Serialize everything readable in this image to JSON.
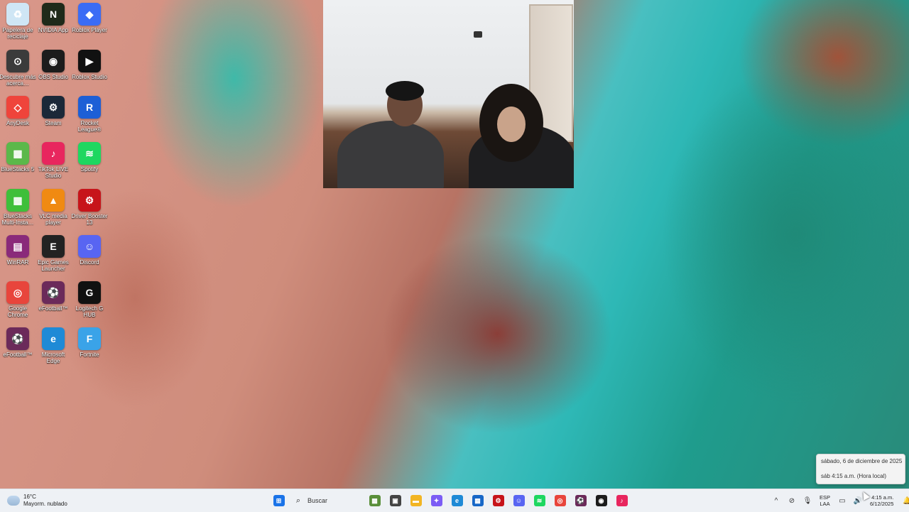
{
  "desktop_icons": [
    {
      "label": "Papelera de reciclaje",
      "icon": "recycle-bin-icon",
      "color": "#cfe6f5",
      "glyph": "♻"
    },
    {
      "label": "NVIDIA App",
      "icon": "nvidia-icon",
      "color": "#1f2a1a",
      "glyph": "N"
    },
    {
      "label": "Roblox Player",
      "icon": "roblox-icon",
      "color": "#3b6cf5",
      "glyph": "◆"
    },
    {
      "label": "Descubre más acerca…",
      "icon": "spotlight-icon",
      "color": "#3b3b3b",
      "glyph": "⊙"
    },
    {
      "label": "OBS Studio",
      "icon": "obs-icon",
      "color": "#1c1c1c",
      "glyph": "◉"
    },
    {
      "label": "Roblox Studio",
      "icon": "roblox-studio-icon",
      "color": "#111111",
      "glyph": "▶"
    },
    {
      "label": "AnyDesk",
      "icon": "anydesk-icon",
      "color": "#ef443b",
      "glyph": "◇"
    },
    {
      "label": "Steam",
      "icon": "steam-icon",
      "color": "#1b2838",
      "glyph": "⚙"
    },
    {
      "label": "Rocket League®",
      "icon": "rocket-league-icon",
      "color": "#1d5fd6",
      "glyph": "R"
    },
    {
      "label": "BlueStacks 5",
      "icon": "bluestacks-icon",
      "color": "#5bb84a",
      "glyph": "▦"
    },
    {
      "label": "TikTok LIVE Studio",
      "icon": "tiktok-live-icon",
      "color": "#e8265e",
      "glyph": "♪"
    },
    {
      "label": "Spotify",
      "icon": "spotify-icon",
      "color": "#1ed760",
      "glyph": "≋"
    },
    {
      "label": "BlueStacks Multi-Insta…",
      "icon": "bluestacks-multi-icon",
      "color": "#3fbf3a",
      "glyph": "▦"
    },
    {
      "label": "VLC media player",
      "icon": "vlc-icon",
      "color": "#f08a12",
      "glyph": "▲"
    },
    {
      "label": "Driver Booster 13",
      "icon": "driver-booster-icon",
      "color": "#c7141a",
      "glyph": "⚙"
    },
    {
      "label": "WinRAR",
      "icon": "winrar-icon",
      "color": "#8a2a7a",
      "glyph": "▤"
    },
    {
      "label": "Epic Games Launcher",
      "icon": "epic-games-icon",
      "color": "#222222",
      "glyph": "E"
    },
    {
      "label": "Discord",
      "icon": "discord-icon",
      "color": "#5865f2",
      "glyph": "☺"
    },
    {
      "label": "Google Chrome",
      "icon": "chrome-icon",
      "color": "#e8453c",
      "glyph": "◎"
    },
    {
      "label": "eFootball™",
      "icon": "efootball-icon",
      "color": "#6b2a5a",
      "glyph": "⚽"
    },
    {
      "label": "Logitech G HUB",
      "icon": "logitech-ghub-icon",
      "color": "#111111",
      "glyph": "G"
    },
    {
      "label": "eFootball™",
      "icon": "efootball-icon-2",
      "color": "#6b2a5a",
      "glyph": "⚽"
    },
    {
      "label": "Microsoft Edge",
      "icon": "edge-icon",
      "color": "#1f8ad6",
      "glyph": "e"
    },
    {
      "label": "Fortnite",
      "icon": "fortnite-icon",
      "color": "#3aa3e8",
      "glyph": "F"
    }
  ],
  "tooltip": {
    "date": "sábado, 6 de diciembre de 2025",
    "time": "sáb 4:15 a.m. (Hora local)"
  },
  "taskbar": {
    "weather_temp": "16°C",
    "weather_desc": "Mayorm. nublado",
    "search_placeholder": "Buscar",
    "pinned": [
      {
        "icon": "windows-start-icon",
        "color": "#1a73e8",
        "glyph": "⊞"
      },
      {
        "icon": "search-icon",
        "color": "",
        "glyph": "⌕"
      },
      {
        "icon": "minecraft-icon",
        "color": "#5a8f3a",
        "glyph": "▩"
      },
      {
        "icon": "task-view-icon",
        "color": "#444444",
        "glyph": "▣"
      },
      {
        "icon": "file-explorer-icon",
        "color": "#f2b523",
        "glyph": "▬"
      },
      {
        "icon": "copilot-icon",
        "color": "#7b5cf5",
        "glyph": "✦"
      },
      {
        "icon": "edge-taskbar-icon",
        "color": "#1f8ad6",
        "glyph": "e"
      },
      {
        "icon": "store-icon",
        "color": "#1767c7",
        "glyph": "▦"
      },
      {
        "icon": "driver-booster-taskbar-icon",
        "color": "#c7141a",
        "glyph": "⚙"
      },
      {
        "icon": "discord-taskbar-icon",
        "color": "#5865f2",
        "glyph": "☺"
      },
      {
        "icon": "spotify-taskbar-icon",
        "color": "#1ed760",
        "glyph": "≋"
      },
      {
        "icon": "chrome-taskbar-icon",
        "color": "#e8453c",
        "glyph": "◎"
      },
      {
        "icon": "efootball-taskbar-icon",
        "color": "#6b2a5a",
        "glyph": "⚽"
      },
      {
        "icon": "obs-taskbar-icon",
        "color": "#1c1c1c",
        "glyph": "◉"
      },
      {
        "icon": "tiktok-taskbar-icon",
        "color": "#e8265e",
        "glyph": "♪"
      }
    ],
    "tray": {
      "lang_top": "ESP",
      "lang_bottom": "LAA",
      "time": "4:15 a.m.",
      "date": "6/12/2025"
    }
  }
}
